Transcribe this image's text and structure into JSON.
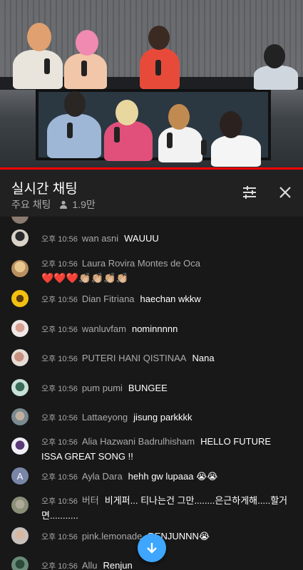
{
  "video": {
    "progress_fraction": 1.0,
    "accent": "#ff0000"
  },
  "header": {
    "title": "실시간 채팅",
    "mode": "주요 채팅",
    "viewers": "1.9만",
    "icons": [
      "tune-icon",
      "close-icon"
    ]
  },
  "messages": [
    {
      "time": "오후 10:56",
      "author": "wan asni",
      "text": "WAUUU"
    },
    {
      "time": "오후 10:56",
      "author": "Laura Rovira Montes de Oca",
      "text": "❤️❤️❤️👏🏼👏🏼👏🏼👏🏼"
    },
    {
      "time": "오후 10:56",
      "author": "Dian Fitriana",
      "text": "haechan wkkw"
    },
    {
      "time": "오후 10:56",
      "author": "wanluvfam",
      "text": "nominnnnn"
    },
    {
      "time": "오후 10:56",
      "author": "PUTERI HANI QISTINAA",
      "text": "Nana"
    },
    {
      "time": "오후 10:56",
      "author": "pum pumi",
      "text": "BUNGEE"
    },
    {
      "time": "오후 10:56",
      "author": "Lattaeyong",
      "text": "jisung parkkkk"
    },
    {
      "time": "오후 10:56",
      "author": "Alia Hazwani Badrulhisham",
      "text": "HELLO FUTURE ISSA GREAT SONG !!"
    },
    {
      "time": "오후 10:56",
      "author": "Ayla Dara",
      "text": "hehh gw lupaaa 😭😭"
    },
    {
      "time": "오후 10:56",
      "author": "버터",
      "text": "비게퍼... 티나는건 그만........은근하게해.....할거면..........."
    },
    {
      "time": "오후 10:56",
      "author": "pink.lemonade",
      "text": "RENJUNNN😭"
    },
    {
      "time": "오후 10:56",
      "author": "Allu",
      "text": "Renjun"
    }
  ],
  "avatar_initial": "A",
  "colors": {
    "background": "#181818",
    "header": "#212121",
    "secondary_text": "#aaaaaa",
    "fab": "#3ea6ff"
  }
}
